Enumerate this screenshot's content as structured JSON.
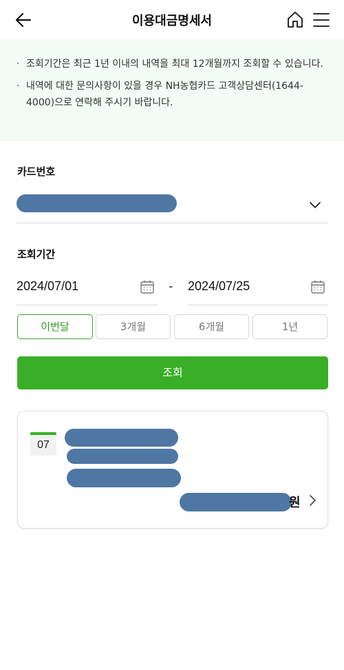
{
  "header": {
    "title": "이용대금명세서",
    "back_icon": "arrow-left-icon",
    "home_icon": "home-icon",
    "menu_icon": "hamburger-menu-icon"
  },
  "notice": {
    "items": [
      "조회기간은 최근 1년 이내의 내역을 최대 12개월까지 조회할 수 있습니다.",
      "내역에 대한 문의사항이 있을 경우 NH농협카드 고객상담센터(1644-4000)으로 연락해 주시기 바랍니다."
    ]
  },
  "card": {
    "label": "카드번호"
  },
  "period": {
    "label": "조회기간",
    "start_date": "2024/07/01",
    "separator": "-",
    "end_date": "2024/07/25",
    "options": [
      "이번달",
      "3개월",
      "6개월",
      "1년"
    ],
    "selected": "이번달"
  },
  "search": {
    "label": "조회"
  },
  "statement": {
    "month": "07",
    "currency_suffix": "원"
  },
  "colors": {
    "accent": "#3aae27",
    "notice_bg": "#f2fbf5",
    "redaction": "#4f77a4"
  }
}
